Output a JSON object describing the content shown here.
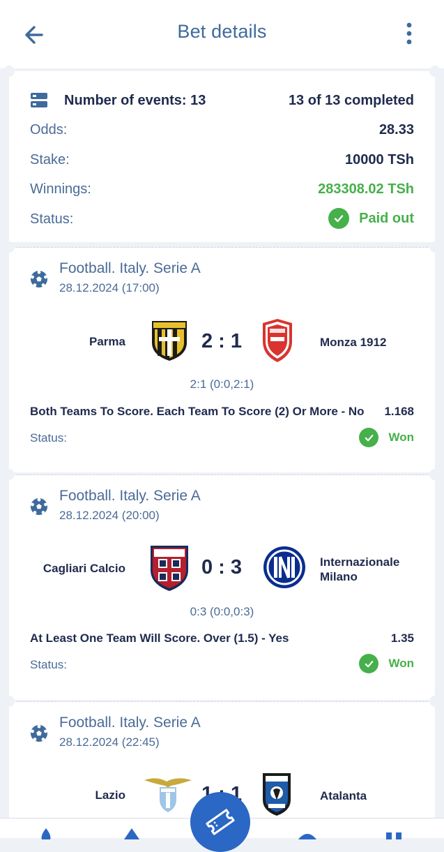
{
  "header": {
    "title": "Bet details"
  },
  "summary": {
    "events_label": "Number of events: 13",
    "completed": "13 of 13 completed",
    "odds_label": "Odds:",
    "odds_value": "28.33",
    "stake_label": "Stake:",
    "stake_value": "10000 TSh",
    "winnings_label": "Winnings:",
    "winnings_value": "283308.02 TSh",
    "status_label": "Status:",
    "status_value": "Paid out"
  },
  "events": [
    {
      "league": "Football. Italy. Serie A",
      "datetime": "28.12.2024 (17:00)",
      "home": "Parma",
      "away": "Monza 1912",
      "score": "2 : 1",
      "subscore": "2:1 (0:0,2:1)",
      "market": "Both Teams To Score. Each Team To Score (2) Or More - No",
      "odd": "1.168",
      "status_label": "Status:",
      "status": "Won"
    },
    {
      "league": "Football. Italy. Serie A",
      "datetime": "28.12.2024 (20:00)",
      "home": "Cagliari Calcio",
      "away": "Internazionale Milano",
      "score": "0 : 3",
      "subscore": "0:3 (0:0,0:3)",
      "market": "At Least One Team Will Score. Over (1.5) - Yes",
      "odd": "1.35",
      "status_label": "Status:",
      "status": "Won"
    },
    {
      "league": "Football. Italy. Serie A",
      "datetime": "28.12.2024 (22:45)",
      "home": "Lazio",
      "away": "Atalanta",
      "score": "1 : 1"
    }
  ],
  "icons": {
    "back": "arrow-left-icon",
    "menu": "more-vertical-icon",
    "summary": "ticket-list-icon",
    "sport": "soccer-ball-icon",
    "status": "check-circle-icon",
    "fab": "coupon-icon"
  },
  "colors": {
    "accent": "#3f6a9c",
    "success": "#46b04a",
    "primary": "#2b67c4",
    "text": "#1f2a4d"
  }
}
